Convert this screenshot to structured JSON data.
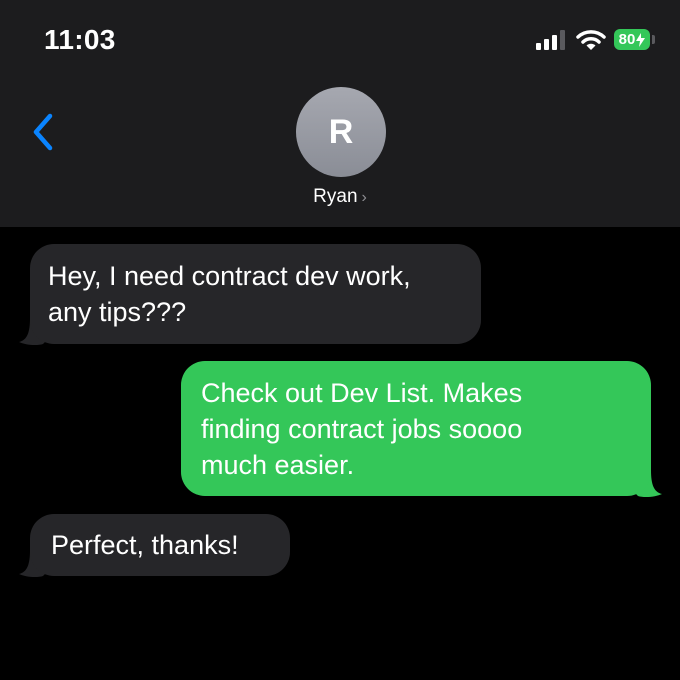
{
  "status_bar": {
    "time": "11:03",
    "battery_percent": "80",
    "signal_bars_active": 3,
    "signal_bars_total": 4,
    "icons": [
      "cellular-signal-icon",
      "wifi-icon",
      "battery-charging-icon"
    ]
  },
  "header": {
    "back_icon": "chevron-left-icon",
    "avatar_initial": "R",
    "contact_name": "Ryan",
    "contact_chevron": "›"
  },
  "messages": [
    {
      "direction": "incoming",
      "text": "Hey, I need contract dev work,\nany tips???"
    },
    {
      "direction": "outgoing",
      "text": "Check out Dev List. Makes\nfinding contract jobs soooo\nmuch easier."
    },
    {
      "direction": "incoming",
      "text": "Perfect, thanks!"
    }
  ],
  "colors": {
    "background": "#000000",
    "header_background": "#1c1c1e",
    "incoming_bubble": "#262629",
    "outgoing_bubble": "#34c759",
    "accent_blue": "#0a84ff",
    "battery_green": "#34c759"
  }
}
